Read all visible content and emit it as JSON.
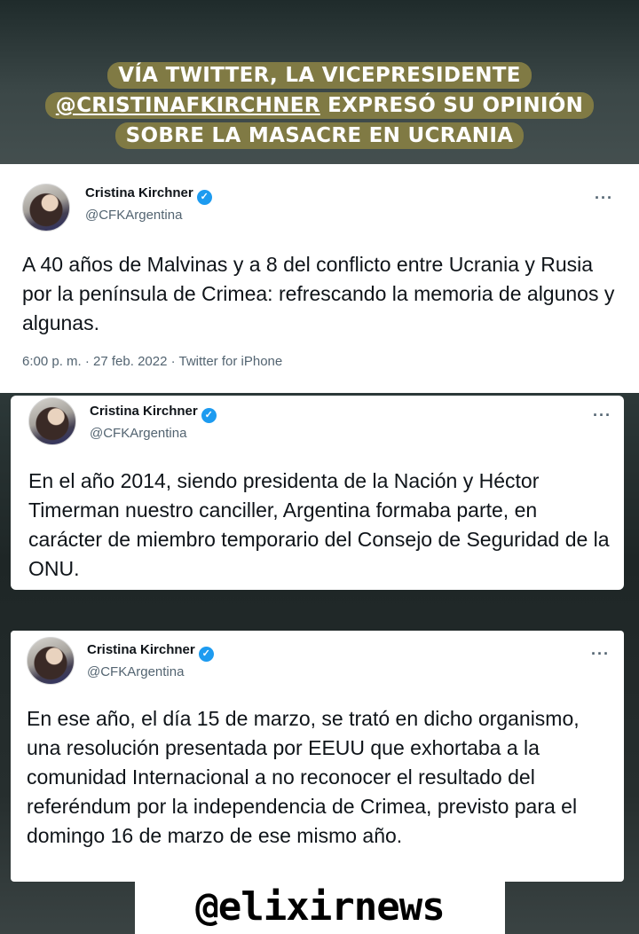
{
  "headline": {
    "line1": "VÍA TWITTER, LA VICEPRESIDENTE",
    "line2_handle": "@CRISTINAFKIRCHNER",
    "line2_rest": " EXPRESÓ SU OPINIÓN",
    "line3": "SOBRE LA MASACRE EN UCRANIA"
  },
  "tweets": [
    {
      "name": "Cristina Kirchner",
      "handle": "@CFKArgentina",
      "text": "A 40 años de Malvinas y a 8 del conflicto entre Ucrania y Rusia por la península de Crimea: refrescando la memoria de algunos y algunas.",
      "meta": "6:00 p. m. · 27 feb. 2022 · Twitter for iPhone",
      "more": "···"
    },
    {
      "name": "Cristina Kirchner",
      "handle": "@CFKArgentina",
      "text": "En el año 2014, siendo presidenta de la Nación y Héctor Timerman nuestro canciller, Argentina formaba parte, en carácter de miembro temporario del Consejo de Seguridad de la ONU.",
      "more": "···"
    },
    {
      "name": "Cristina Kirchner",
      "handle": "@CFKArgentina",
      "text": "En ese año, el día 15 de marzo, se trató en dicho organismo, una resolución presentada por EEUU que exhortaba a la comunidad Internacional a no reconocer el resultado del referéndum por la independencia de Crimea, previsto para el domingo 16 de marzo de ese mismo año.",
      "more": "···"
    }
  ],
  "verified_glyph": "✓",
  "watermark": "@elixirnews",
  "colors": {
    "headline_highlight": "#807a44",
    "verified": "#1d9bf0",
    "secondary_text": "#536471"
  }
}
